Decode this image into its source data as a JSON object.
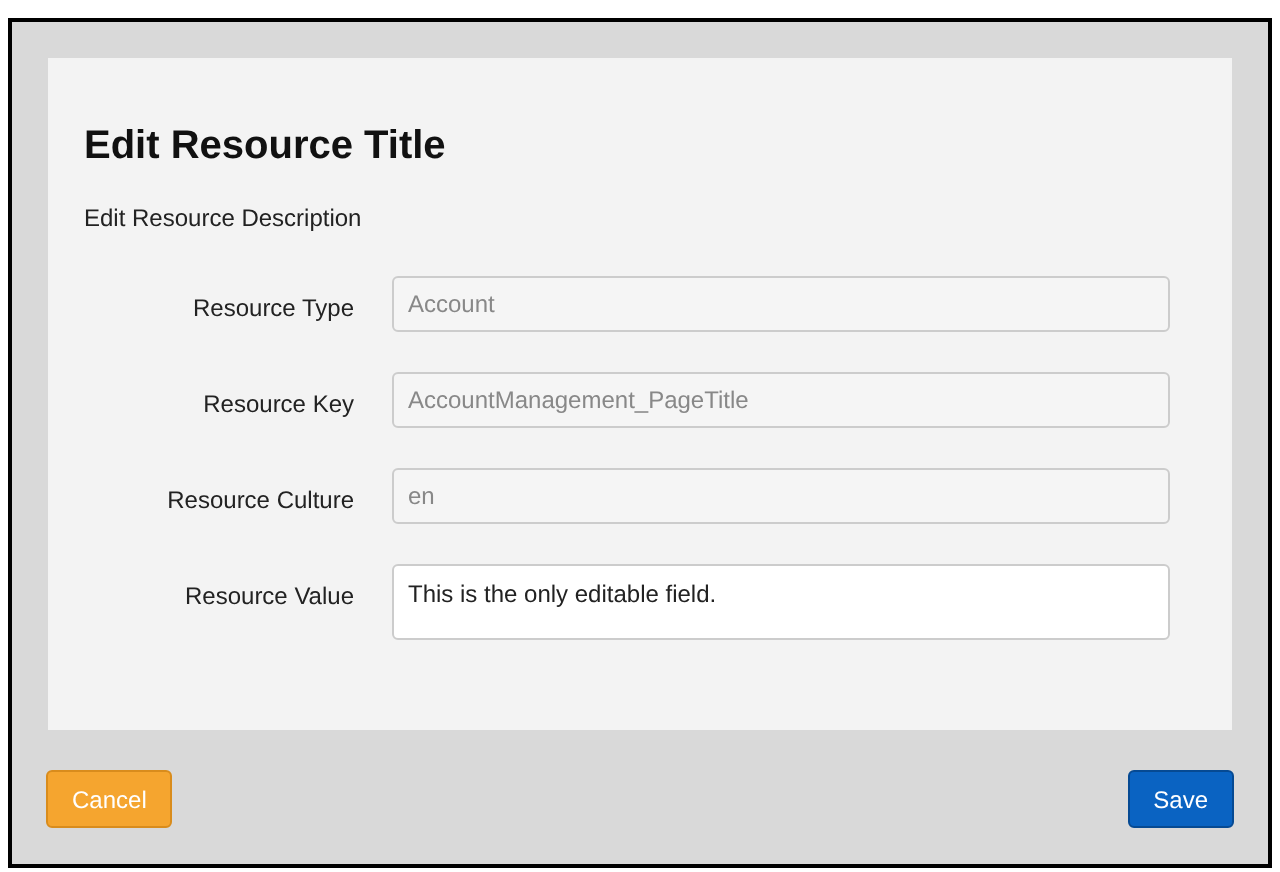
{
  "title": "Edit Resource Title",
  "description": "Edit Resource Description",
  "fields": [
    {
      "label": "Resource Type",
      "value": "Account",
      "disabled": true,
      "kind": "input"
    },
    {
      "label": "Resource Key",
      "value": "AccountManagement_PageTitle",
      "disabled": true,
      "kind": "input"
    },
    {
      "label": "Resource Culture",
      "value": "en",
      "disabled": true,
      "kind": "input"
    },
    {
      "label": "Resource Value",
      "value": "This is the only editable field.",
      "disabled": false,
      "kind": "textarea"
    }
  ],
  "buttons": [
    {
      "label": "Cancel",
      "kind": "cancel"
    },
    {
      "label": "Save",
      "kind": "primary"
    }
  ]
}
